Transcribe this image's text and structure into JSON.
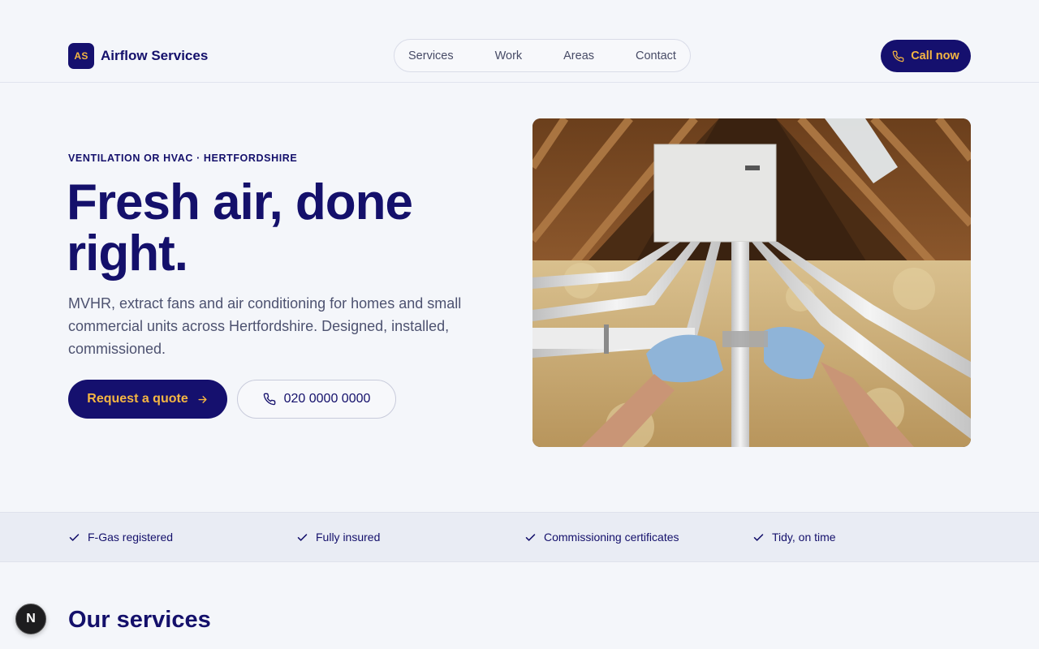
{
  "header": {
    "brand_badge": "AS",
    "brand_name": "Airflow Services",
    "nav": [
      "Services",
      "Work",
      "Areas",
      "Contact"
    ],
    "call_label": "Call now"
  },
  "hero": {
    "eyebrow": "VENTILATION OR HVAC · HERTFORDSHIRE",
    "headline": "Fresh air, done right.",
    "lead": "MVHR, extract fans and air conditioning for homes and small commercial units across Hertfordshire. Designed, installed, commissioned.",
    "quote_label": "Request a quote",
    "phone_label": "020 0000 0000",
    "image_alt": "photo-of-gloved-hands-fitting-ventilation-ducts-in-loft"
  },
  "trust": [
    "F-Gas registered",
    "Fully insured",
    "Commissioning certificates",
    "Tidy, on time"
  ],
  "services": {
    "title": "Our services"
  },
  "dev_badge": "N",
  "colors": {
    "navy": "#15106e",
    "accent": "#f5b642",
    "bg": "#f4f6fa"
  }
}
